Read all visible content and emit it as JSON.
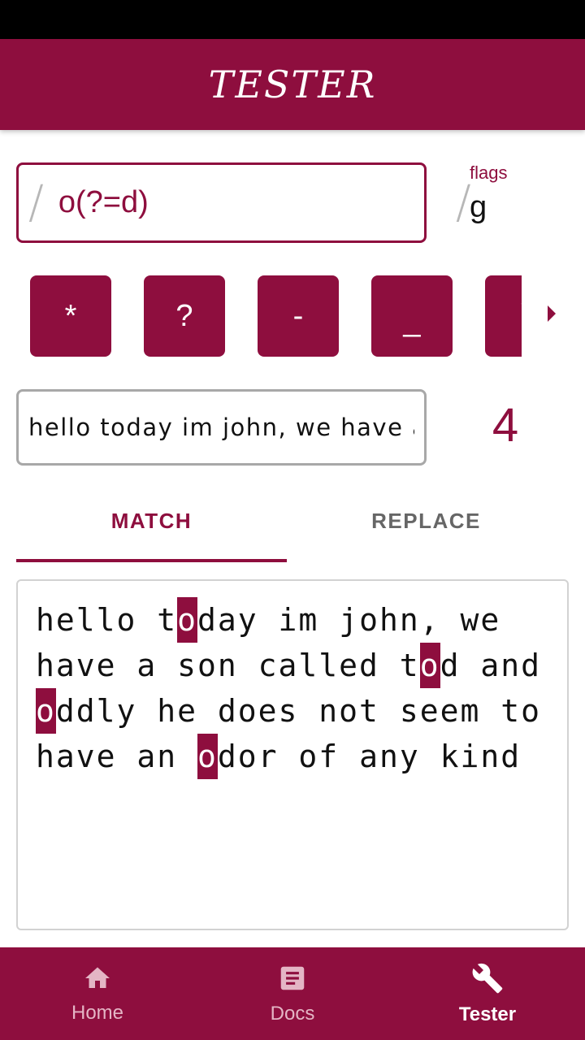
{
  "app": {
    "title": "TESTER"
  },
  "regex": {
    "pattern": "o(?=d)",
    "slash_open": "/",
    "slash_close": "/"
  },
  "flags": {
    "label": "flags",
    "value": "g"
  },
  "chips": [
    "*",
    "?",
    "-",
    "_",
    "\\"
  ],
  "test_input": {
    "value": "hello today im john, we have a"
  },
  "match_count": "4",
  "tabs": {
    "match": "MATCH",
    "replace": "REPLACE",
    "active": "match"
  },
  "result": {
    "segments": [
      {
        "text": "hello t",
        "hl": false
      },
      {
        "text": "o",
        "hl": true
      },
      {
        "text": "day im john, we have a son called t",
        "hl": false
      },
      {
        "text": "o",
        "hl": true
      },
      {
        "text": "d and ",
        "hl": false
      },
      {
        "text": "o",
        "hl": true
      },
      {
        "text": "ddly he does not seem to have an ",
        "hl": false
      },
      {
        "text": "o",
        "hl": true
      },
      {
        "text": "dor of any kind",
        "hl": false
      }
    ]
  },
  "nav": {
    "items": [
      {
        "label": "Home",
        "icon": "home-icon",
        "active": false
      },
      {
        "label": "Docs",
        "icon": "docs-icon",
        "active": false
      },
      {
        "label": "Tester",
        "icon": "wrench-icon",
        "active": true
      }
    ]
  },
  "colors": {
    "accent": "#8e0e3e",
    "inactive_nav": "#e4b5c5"
  }
}
